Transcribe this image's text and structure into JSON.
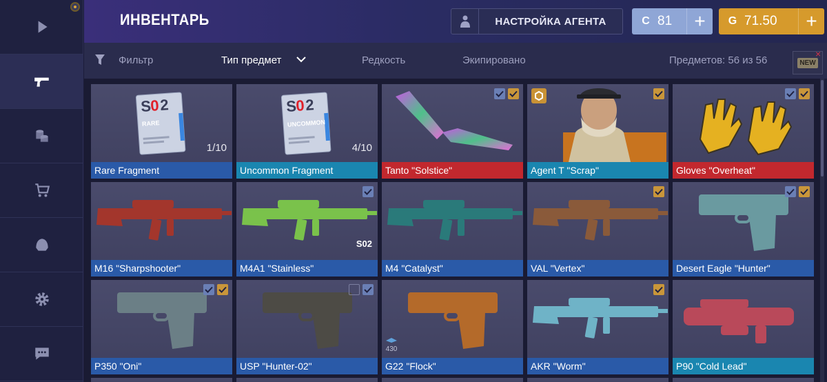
{
  "header": {
    "title": "ИНВЕНТАРЬ",
    "agent_button": "НАСТРОЙКА АГЕНТА",
    "silver": {
      "value": "81",
      "icon": "C",
      "color": "#8fa6d6"
    },
    "gold": {
      "value": "71.50",
      "icon": "G",
      "color": "#d69a2c"
    },
    "plus": "+"
  },
  "sidebar": {
    "items": [
      {
        "icon": "play-icon",
        "active": false
      },
      {
        "icon": "pistol-icon",
        "active": true
      },
      {
        "icon": "coins-icon",
        "active": false
      },
      {
        "icon": "cart-icon",
        "active": false
      },
      {
        "icon": "helmet-icon",
        "active": false
      },
      {
        "icon": "gear-icon",
        "active": false
      },
      {
        "icon": "chat-icon",
        "active": false
      }
    ]
  },
  "filters": {
    "filter": "Фильтр",
    "type": "Тип предмет",
    "rarity": "Редкость",
    "equipped": "Экипировано",
    "count": "Предметов: 56 из 56",
    "new_badge": "NEW",
    "close": "×"
  },
  "items": [
    {
      "name": "Rare Fragment",
      "rarity": "blue",
      "count": "1/10",
      "checks": [],
      "kind": "fragment",
      "frag_label": "RARE"
    },
    {
      "name": "Uncommon Fragment",
      "rarity": "cyan",
      "count": "4/10",
      "checks": [],
      "kind": "fragment",
      "frag_label": "UNCOMMON"
    },
    {
      "name": "Tanto \"Solstice\"",
      "rarity": "red",
      "checks": [
        "blue",
        "gold"
      ],
      "kind": "knife"
    },
    {
      "name": "Agent T \"Scrap\"",
      "rarity": "cyan",
      "checks": [
        "gold"
      ],
      "kind": "agent"
    },
    {
      "name": "Gloves \"Overheat\"",
      "rarity": "red",
      "checks": [
        "blue",
        "gold"
      ],
      "kind": "gloves"
    },
    {
      "name": "M16 \"Sharpshooter\"",
      "rarity": "blue",
      "checks": [],
      "kind": "rifle"
    },
    {
      "name": "M4A1 \"Stainless\"",
      "rarity": "blue",
      "checks": [
        "blue"
      ],
      "kind": "rifle",
      "tag": "S02"
    },
    {
      "name": "M4 \"Catalyst\"",
      "rarity": "blue",
      "checks": [],
      "kind": "rifle"
    },
    {
      "name": "VAL \"Vertex\"",
      "rarity": "blue",
      "checks": [
        "gold"
      ],
      "kind": "rifle"
    },
    {
      "name": "Desert Eagle \"Hunter\"",
      "rarity": "blue",
      "checks": [
        "blue",
        "gold"
      ],
      "kind": "pistol"
    },
    {
      "name": "P350 \"Oni\"",
      "rarity": "blue",
      "checks": [
        "blue",
        "gold"
      ],
      "kind": "pistol"
    },
    {
      "name": "USP \"Hunter-02\"",
      "rarity": "blue",
      "checks": [
        "outline",
        "blue"
      ],
      "kind": "pistol"
    },
    {
      "name": "G22 \"Flock\"",
      "rarity": "blue",
      "checks": [],
      "kind": "pistol",
      "stack": "430"
    },
    {
      "name": "AKR \"Worm\"",
      "rarity": "blue",
      "checks": [
        "gold"
      ],
      "kind": "rifle"
    },
    {
      "name": "P90 \"Cold Lead\"",
      "rarity": "cyan",
      "checks": [],
      "kind": "smg"
    }
  ]
}
